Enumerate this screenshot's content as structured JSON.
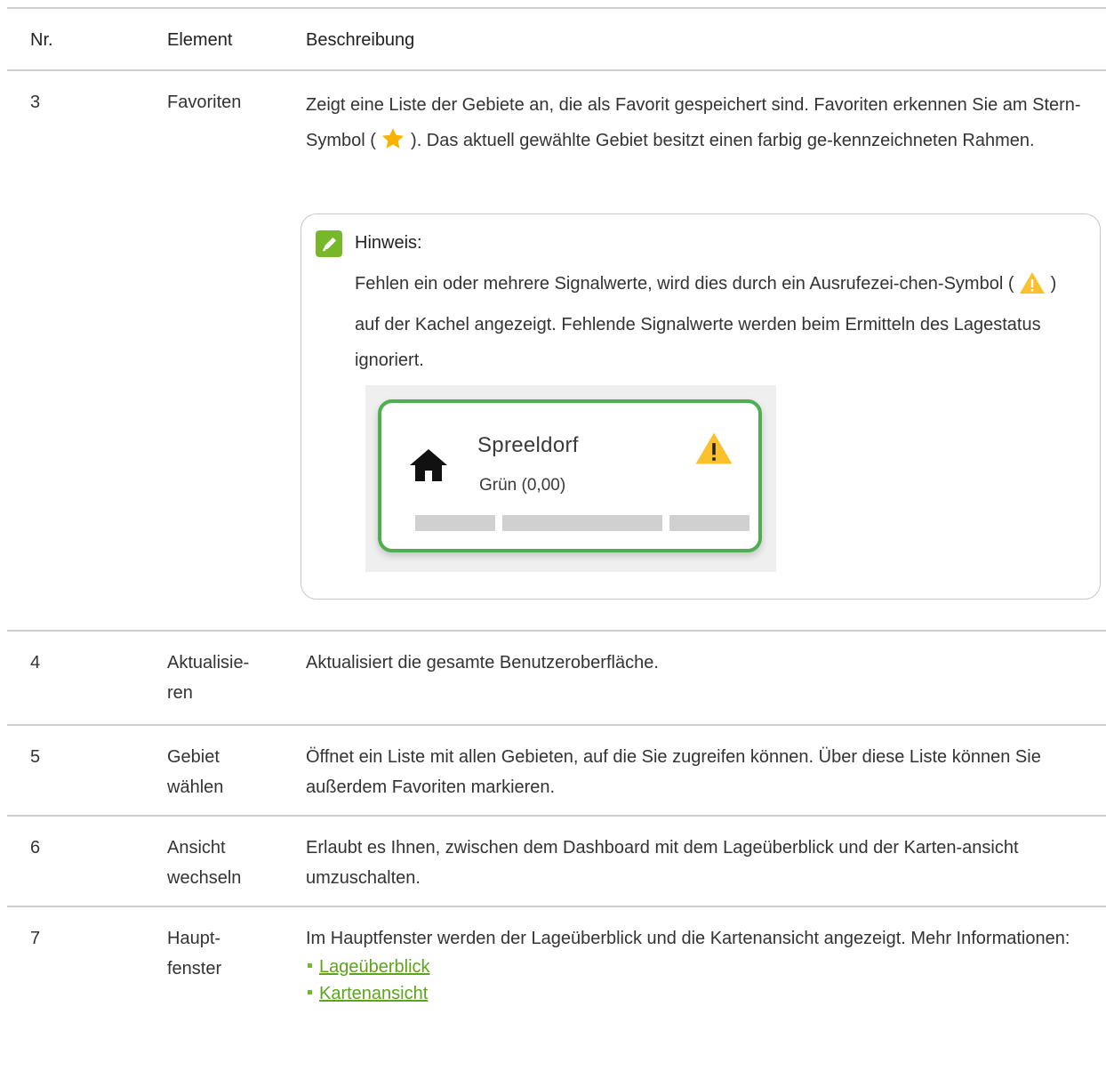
{
  "header": {
    "nr": "Nr.",
    "element": "Element",
    "description": "Beschreibung"
  },
  "rows": [
    {
      "nr": "3",
      "element": "Favoriten",
      "description_parts": [
        "Zeigt eine Liste der Gebiete an, die als Favorit gespeichert sind. Favoriten erkennen Sie am Stern-Symbol (",
        "). Das aktuell gewählte Gebiet besitzt einen farbig ge-kennzeichneten Rahmen."
      ],
      "note": {
        "title": "Hinweis:",
        "text_parts": [
          "Fehlen ein oder mehrere Signalwerte, wird dies durch ein Ausrufezei-chen-Symbol (",
          ") auf der Kachel angezeigt. Fehlende Signalwerte werden beim Ermitteln des Lagestatus ignoriert."
        ],
        "tile": {
          "name": "Spreeldorf",
          "status": "Grün (0,00)",
          "border_color": "#4caf50",
          "icons": [
            "home-icon",
            "warning-icon"
          ]
        }
      }
    },
    {
      "nr": "4",
      "element": "Aktualisie-ren",
      "description": "Aktualisiert die gesamte Benutzeroberfläche."
    },
    {
      "nr": "5",
      "element": "Gebiet wählen",
      "description": "Öffnet ein Liste mit allen Gebieten, auf die Sie zugreifen können. Über diese Liste können Sie außerdem Favoriten markieren."
    },
    {
      "nr": "6",
      "element": "Ansicht wechseln",
      "description": "Erlaubt es Ihnen, zwischen dem Dashboard mit dem Lageüberblick und der Karten-ansicht umzuschalten."
    },
    {
      "nr": "7",
      "element": "Haupt-fenster",
      "description": "Im Hauptfenster werden der Lageüberblick und die Kartenansicht angezeigt. Mehr Informationen:",
      "links": [
        "Lageüberblick",
        "Kartenansicht"
      ]
    }
  ],
  "colors": {
    "accent": "#76b82a",
    "link": "#5aa51d",
    "star": "#f5b400",
    "warning": "#fbc02d",
    "divider": "#cfcfcf"
  }
}
